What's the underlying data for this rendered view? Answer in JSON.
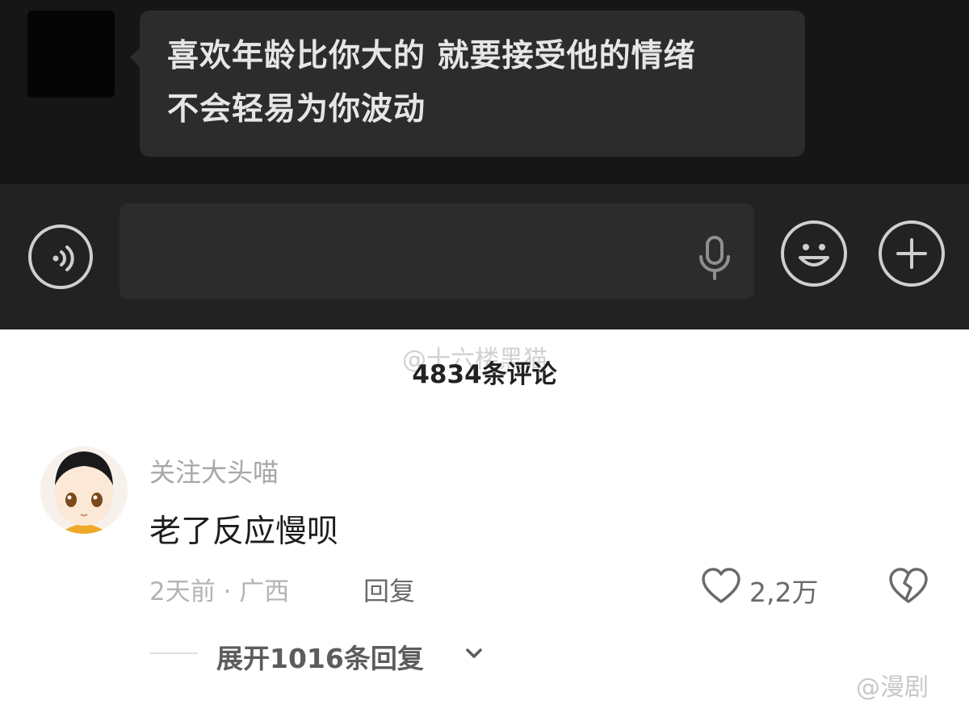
{
  "chat": {
    "message_line1": "喜欢年龄比你大的 就要接受他的情绪",
    "message_line2": "不会轻易为你波动",
    "input_placeholder": ""
  },
  "icons": {
    "voice": "voice-wave-icon",
    "mic": "microphone-icon",
    "emoji": "smiley-icon",
    "plus": "plus-icon",
    "heart": "heart-icon",
    "dislike": "broken-heart-icon",
    "chevron": "chevron-down-icon"
  },
  "comments": {
    "count_label": "4834条评论",
    "watermark_top": "@十六楼黑猫",
    "items": [
      {
        "username": "关注大头喵",
        "text": "老了反应慢呗",
        "meta": "2天前 · 广西",
        "reply_label": "回复",
        "likes": "2,2万",
        "expand_label": "展开1016条回复"
      }
    ]
  },
  "watermark_bottom": "@漫剧",
  "colors": {
    "chat_bg": "#161616",
    "bubble_bg": "#2c2c2c",
    "input_bar_bg": "#222222"
  }
}
